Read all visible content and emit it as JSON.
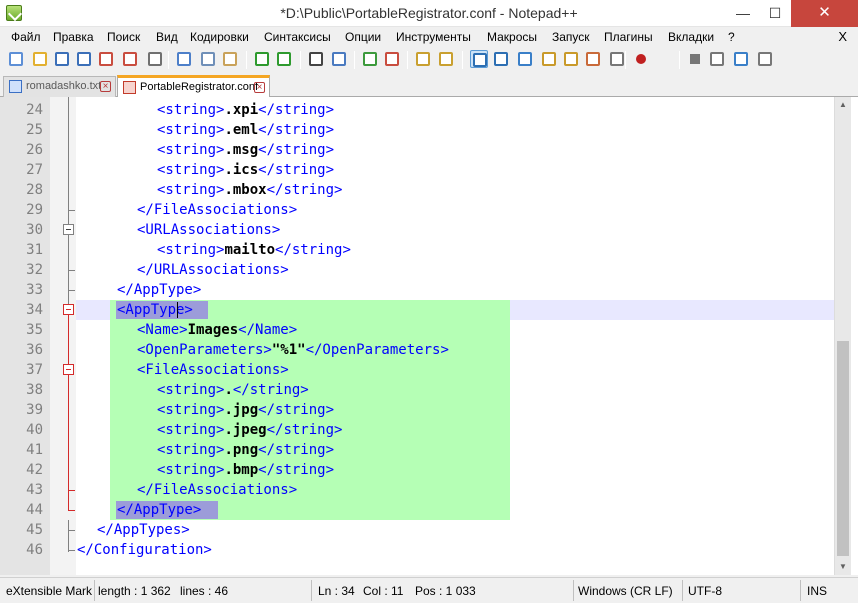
{
  "window": {
    "title": "*D:\\Public\\PortableRegistrator.conf - Notepad++",
    "minimize": "—",
    "maximize": "☐",
    "close": "✕"
  },
  "menu": {
    "items": [
      "Файл",
      "Правка",
      "Поиск",
      "Вид",
      "Кодировки",
      "Синтаксисы",
      "Опции",
      "Инструменты",
      "Макросы",
      "Запуск",
      "Плагины",
      "Вкладки",
      "?"
    ],
    "close_doc": "X"
  },
  "toolbar": {
    "icons": [
      "new-file-icon",
      "open-file-icon",
      "save-icon",
      "save-all-icon",
      "close-icon",
      "close-all-icon",
      "print-icon",
      "cut-icon",
      "copy-icon",
      "paste-icon",
      "undo-icon",
      "redo-icon",
      "find-icon",
      "replace-icon",
      "zoom-in-icon",
      "zoom-out-icon",
      "sync-vertical-icon",
      "sync-horizontal-icon",
      "word-wrap-icon",
      "show-all-chars-icon",
      "indent-guide-icon",
      "doc-map-icon",
      "function-list-icon",
      "folder-workspace-icon",
      "monitoring-icon",
      "record-macro-icon",
      "stop-macro-icon",
      "play-macro-icon",
      "run-macro-multiple-icon",
      "save-macro-icon"
    ]
  },
  "tabs": [
    {
      "label": "romadashko.txt",
      "active": false
    },
    {
      "label": "PortableRegistrator.conf",
      "active": true
    }
  ],
  "editor": {
    "lines": [
      {
        "n": "24",
        "indent": 8,
        "parts": [
          [
            "t",
            "<string>"
          ],
          [
            "v",
            ".xpi"
          ],
          [
            "t",
            "</string>"
          ]
        ]
      },
      {
        "n": "25",
        "indent": 8,
        "parts": [
          [
            "t",
            "<string>"
          ],
          [
            "v",
            ".eml"
          ],
          [
            "t",
            "</string>"
          ]
        ]
      },
      {
        "n": "26",
        "indent": 8,
        "parts": [
          [
            "t",
            "<string>"
          ],
          [
            "v",
            ".msg"
          ],
          [
            "t",
            "</string>"
          ]
        ]
      },
      {
        "n": "27",
        "indent": 8,
        "parts": [
          [
            "t",
            "<string>"
          ],
          [
            "v",
            ".ics"
          ],
          [
            "t",
            "</string>"
          ]
        ]
      },
      {
        "n": "28",
        "indent": 8,
        "parts": [
          [
            "t",
            "<string>"
          ],
          [
            "v",
            ".mbox"
          ],
          [
            "t",
            "</string>"
          ]
        ]
      },
      {
        "n": "29",
        "indent": 6,
        "parts": [
          [
            "t",
            "</FileAssociations>"
          ]
        ]
      },
      {
        "n": "30",
        "indent": 6,
        "parts": [
          [
            "t",
            "<URLAssociations>"
          ]
        ]
      },
      {
        "n": "31",
        "indent": 8,
        "parts": [
          [
            "t",
            "<string>"
          ],
          [
            "v",
            "mailto"
          ],
          [
            "t",
            "</string>"
          ]
        ]
      },
      {
        "n": "32",
        "indent": 6,
        "parts": [
          [
            "t",
            "</URLAssociations>"
          ]
        ]
      },
      {
        "n": "33",
        "indent": 4,
        "parts": [
          [
            "t",
            "</AppType>"
          ]
        ]
      },
      {
        "n": "34",
        "indent": 4,
        "parts": [
          [
            "t",
            "<AppType>"
          ]
        ]
      },
      {
        "n": "35",
        "indent": 6,
        "parts": [
          [
            "t",
            "<Name>"
          ],
          [
            "v",
            "Images"
          ],
          [
            "t",
            "</Name>"
          ]
        ]
      },
      {
        "n": "36",
        "indent": 6,
        "parts": [
          [
            "t",
            "<OpenParameters>"
          ],
          [
            "v",
            "\"%1\""
          ],
          [
            "t",
            "</OpenParameters>"
          ]
        ]
      },
      {
        "n": "37",
        "indent": 6,
        "parts": [
          [
            "t",
            "<FileAssociations>"
          ]
        ]
      },
      {
        "n": "38",
        "indent": 8,
        "parts": [
          [
            "t",
            "<string>"
          ],
          [
            "v",
            "."
          ],
          [
            "t",
            "</string>"
          ]
        ]
      },
      {
        "n": "39",
        "indent": 8,
        "parts": [
          [
            "t",
            "<string>"
          ],
          [
            "v",
            ".jpg"
          ],
          [
            "t",
            "</string>"
          ]
        ]
      },
      {
        "n": "40",
        "indent": 8,
        "parts": [
          [
            "t",
            "<string>"
          ],
          [
            "v",
            ".jpeg"
          ],
          [
            "t",
            "</string>"
          ]
        ]
      },
      {
        "n": "41",
        "indent": 8,
        "parts": [
          [
            "t",
            "<string>"
          ],
          [
            "v",
            ".png"
          ],
          [
            "t",
            "</string>"
          ]
        ]
      },
      {
        "n": "42",
        "indent": 8,
        "parts": [
          [
            "t",
            "<string>"
          ],
          [
            "v",
            ".bmp"
          ],
          [
            "t",
            "</string>"
          ]
        ]
      },
      {
        "n": "43",
        "indent": 6,
        "parts": [
          [
            "t",
            "</FileAssociations>"
          ]
        ]
      },
      {
        "n": "44",
        "indent": 4,
        "parts": [
          [
            "t",
            "</AppType>"
          ]
        ]
      },
      {
        "n": "45",
        "indent": 2,
        "parts": [
          [
            "t",
            "</AppTypes>"
          ]
        ]
      },
      {
        "n": "46",
        "indent": 0,
        "parts": [
          [
            "t",
            "</Configuration>"
          ]
        ]
      }
    ],
    "current_line": "34"
  },
  "statusbar": {
    "language": "eXtensible Markup Language file",
    "length": "length : 1 362",
    "lines": "lines : 46",
    "ln": "Ln : 34",
    "col": "Col : 11",
    "pos": "Pos : 1 033",
    "eol": "Windows (CR LF)",
    "encoding": "UTF-8",
    "mode": "INS"
  },
  "colors": {
    "tag": "#0000ff",
    "value": "#000000",
    "selection": "#b5ffb5",
    "tag_match": "#9c9cd9",
    "caret_line": "#e8e8ff",
    "close_button": "#c7463d",
    "active_tab_accent": "#f5a623"
  }
}
